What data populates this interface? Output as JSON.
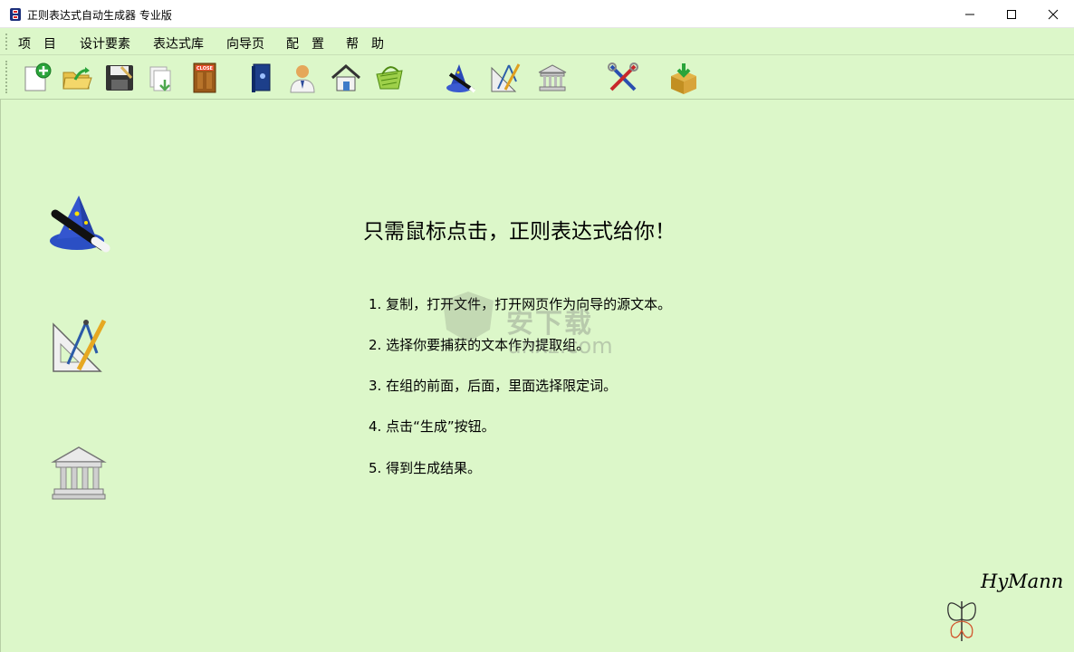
{
  "window": {
    "title": "正则表达式自动生成器 专业版",
    "minimize_glyph": "—",
    "maximize_glyph": "☐",
    "close_glyph": "✕"
  },
  "menu": {
    "items": [
      {
        "label": "项　目"
      },
      {
        "label": "设计要素"
      },
      {
        "label": "表达式库"
      },
      {
        "label": "向导页"
      },
      {
        "label": "配　置"
      },
      {
        "label": "帮　助"
      }
    ]
  },
  "toolbar": {
    "buttons": [
      {
        "icon": "new-document-icon"
      },
      {
        "icon": "open-folder-icon"
      },
      {
        "icon": "save-disk-icon"
      },
      {
        "icon": "export-icon"
      },
      {
        "icon": "close-door-icon",
        "text": "CLOSE"
      },
      {
        "icon": "book-icon"
      },
      {
        "icon": "user-icon"
      },
      {
        "icon": "home-icon"
      },
      {
        "icon": "basket-icon"
      },
      {
        "icon": "wizard-hat-icon"
      },
      {
        "icon": "compass-ruler-icon"
      },
      {
        "icon": "library-icon"
      },
      {
        "icon": "tools-icon"
      },
      {
        "icon": "package-download-icon"
      }
    ]
  },
  "main": {
    "headline": "只需鼠标点击，正则表达式给你！",
    "steps": [
      "1. 复制，打开文件，打开网页作为向导的源文本。",
      "2. 选择你要捕获的文本作为提取组。",
      "3. 在组的前面，后面，里面选择限定词。",
      "4. 点击“生成”按钮。",
      "5. 得到生成结果。"
    ],
    "signature": "HyMann"
  },
  "watermark": {
    "text": "安下载",
    "sub": "anxz.com"
  },
  "colors": {
    "background": "#dcf7c9",
    "titlebar": "#ffffff"
  }
}
